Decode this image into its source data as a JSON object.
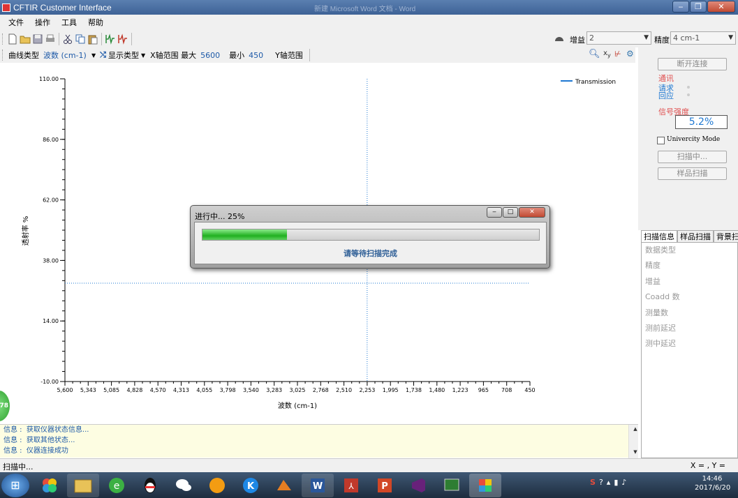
{
  "window": {
    "title": "CFTIR Customer Interface",
    "ghost_title": "新建 Microsoft Word 文档 - Word"
  },
  "menu": [
    "文件",
    "操作",
    "工具",
    "帮助"
  ],
  "toolbar": {
    "gain_label": "增益",
    "gain_value": "2",
    "precision_label": "精度",
    "precision_value": "4   cm-1"
  },
  "toolbar2": {
    "curve_type_label": "曲线类型",
    "curve_type_value": "波数 (cm-1)",
    "display_type_label": "显示类型",
    "x_range_label": "X轴范围 最大",
    "x_max": "5600",
    "min_label": "最小",
    "x_min": "450",
    "y_range_label": "Y轴范围"
  },
  "right_panel": {
    "disconnect": "断开连接",
    "comm": "通讯",
    "request": "请求",
    "response": "回应",
    "signal_label": "信号强度",
    "signal_value": "5.2%",
    "univ_mode": "Univercity Mode",
    "scanning": "扫描中...",
    "sample_scan": "样品扫描"
  },
  "tabs": [
    "扫描信息",
    "样品扫描",
    "背景扫描"
  ],
  "scan_info": [
    "数据类型",
    "精度",
    "增益",
    "Coadd 数",
    "测量数",
    "测前延迟",
    "测中延迟"
  ],
  "chart_data": {
    "type": "line",
    "xlabel": "波数 (cm-1)",
    "ylabel": "透射率 %",
    "x_ticks": [
      "5,600",
      "5,343",
      "5,085",
      "4,828",
      "4,570",
      "4,313",
      "4,055",
      "3,798",
      "3,540",
      "3,283",
      "3,025",
      "2,768",
      "2,510",
      "2,253",
      "1,995",
      "1,738",
      "1,480",
      "1,223",
      "965",
      "708",
      "450"
    ],
    "y_ticks": [
      "110.00",
      "86.00",
      "62.00",
      "38.00",
      "14.00",
      "-10.00"
    ],
    "xlim": [
      5600,
      450
    ],
    "ylim": [
      -10,
      110
    ],
    "series": [
      {
        "name": "Transmission",
        "color": "#1e78d2",
        "x": [],
        "y": []
      }
    ],
    "legend": "top-right",
    "cursor": {
      "x": 2253,
      "y": 29
    }
  },
  "log": [
    {
      "prefix": "信息",
      "text": "获取仪器状态信息..."
    },
    {
      "prefix": "信息",
      "text": "获取其他状态..."
    },
    {
      "prefix": "信息",
      "text": "仪器连接成功"
    }
  ],
  "status": {
    "left": "扫描中...",
    "right": "X = , Y ="
  },
  "dialog": {
    "title": "进行中... 25%",
    "progress": 0.25,
    "message": "请等待扫描完成"
  },
  "badge": "78",
  "taskbar": {
    "time": "14:46",
    "date": "2017/6/20"
  }
}
